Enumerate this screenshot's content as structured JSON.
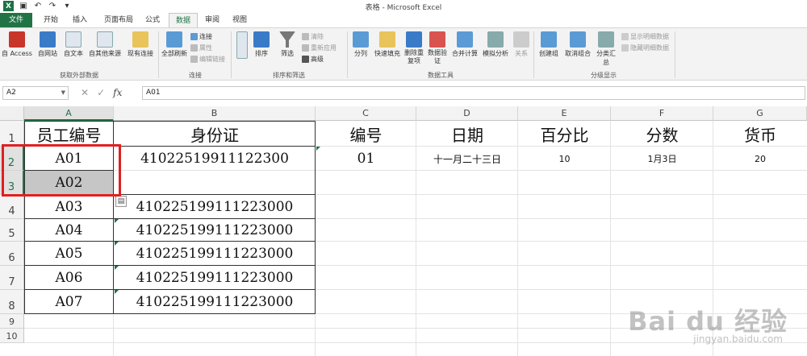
{
  "app": {
    "title": "表格 - Microsoft Excel",
    "logo": "X",
    "accent": "#217346"
  },
  "tabs": [
    {
      "label": "文件",
      "kind": "file"
    },
    {
      "label": "开始"
    },
    {
      "label": "插入"
    },
    {
      "label": "页面布局"
    },
    {
      "label": "公式"
    },
    {
      "label": "数据",
      "active": true
    },
    {
      "label": "审阅"
    },
    {
      "label": "视图"
    }
  ],
  "ribbon": {
    "groups": [
      {
        "name": "获取外部数据",
        "buttons": [
          "自 Access",
          "自网站",
          "自文本",
          "自其他来源",
          "现有连接"
        ]
      },
      {
        "name": "连接",
        "buttons": [
          "全部刷新"
        ],
        "small": [
          "连接",
          "属性",
          "编辑链接"
        ]
      },
      {
        "name": "排序和筛选",
        "buttons": [
          "排序",
          "筛选"
        ],
        "small": [
          "清除",
          "重新应用",
          "高级"
        ]
      },
      {
        "name": "数据工具",
        "buttons": [
          "分列",
          "快速填充",
          "删除重复项",
          "数据验证",
          "合并计算",
          "模拟分析",
          "关系"
        ]
      },
      {
        "name": "分级显示",
        "buttons": [
          "创建组",
          "取消组合",
          "分类汇总"
        ],
        "small": [
          "显示明细数据",
          "隐藏明细数据"
        ]
      }
    ]
  },
  "formula_bar": {
    "name_box": "A2",
    "formula": "A01"
  },
  "columns": [
    "A",
    "B",
    "C",
    "D",
    "E",
    "F",
    "G"
  ],
  "rows": [
    "1",
    "2",
    "3",
    "4",
    "5",
    "6",
    "7",
    "8",
    "9",
    "10"
  ],
  "sheet": {
    "headers": [
      "员工编号",
      "身份证",
      "编号",
      "日期",
      "百分比",
      "分数",
      "货币"
    ],
    "row2": [
      "A01",
      "41022519911122300",
      "01",
      "十一月二十三日",
      "10",
      "1月3日",
      "20"
    ],
    "row3": [
      "A02"
    ],
    "data_rows": [
      [
        "A03",
        "410225199111223000"
      ],
      [
        "A04",
        "410225199111223000"
      ],
      [
        "A05",
        "410225199111223000"
      ],
      [
        "A06",
        "410225199111223000"
      ],
      [
        "A07",
        "410225199111223000"
      ]
    ]
  },
  "watermark": {
    "line1": "Bai du 经验",
    "line2": "jingyan.baidu.com"
  }
}
